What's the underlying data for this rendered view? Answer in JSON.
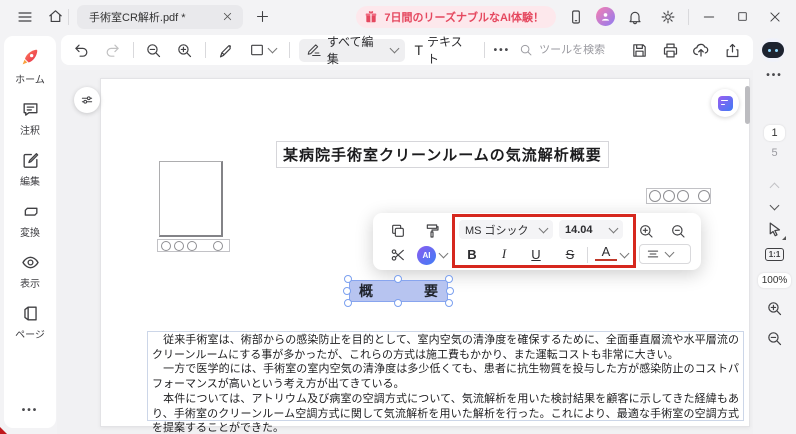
{
  "titlebar": {
    "tab_title": "手術室CR解析.pdf *",
    "banner_text": "7日間のリーズナブルなAI体験！"
  },
  "toolbar": {
    "edit_all_label": "すべて編集",
    "text_tool_icon": "T",
    "text_tool_label": "テキスト",
    "search_placeholder": "ツールを検索"
  },
  "sidebar": {
    "items": [
      {
        "id": "home",
        "label": "ホーム"
      },
      {
        "id": "comment",
        "label": "注釈"
      },
      {
        "id": "edit",
        "label": "編集"
      },
      {
        "id": "convert",
        "label": "変換"
      },
      {
        "id": "view",
        "label": "表示"
      },
      {
        "id": "page",
        "label": "ページ"
      }
    ]
  },
  "float_toolbar": {
    "font_name": "MS ゴシック",
    "font_size": "14.04",
    "bold": "B",
    "italic": "I",
    "underline": "U",
    "strikethrough": "S",
    "font_color": "A",
    "ai_label": "AI"
  },
  "document": {
    "title": "某病院手術室クリーンルームの気流解析概要",
    "selected_word_left": "概",
    "selected_word_right": "要",
    "paragraphs": [
      "　従来手術室は、術部からの感染防止を目的として、室内空気の清浄度を確保するために、全面垂直層流や水平層流のクリーンルームにする事が多かったが、これらの方式は施工費もかかり、また運転コストも非常に大きい。",
      "　一方で医学的には、手術室の室内空気の清浄度は多少低くても、患者に抗生物質を投与した方が感染防止のコストパフォーマンスが高いという考え方が出てきている。",
      "　本件については、アトリウム及び病室の空調方式について、気流解析を用いた検討結果を顧客に示してきた経緯もあり、手術室のクリーンルーム空調方式に関して気流解析を用いた解析を行った。これにより、最適な手術室の空調方式を提案することができた。"
    ]
  },
  "right_rail": {
    "current_page": "1",
    "total_pages": "5",
    "actual_size_label": "1:1",
    "zoom_level": "100%"
  },
  "icons": {
    "ellipsis": "•••"
  },
  "colors": {
    "accent_red": "#e5485f",
    "annotation_red": "#d6281e",
    "selection_blue": "#b7c4f0",
    "ai_gradient_start": "#8a5cf0",
    "ai_gradient_end": "#3f7df5"
  }
}
